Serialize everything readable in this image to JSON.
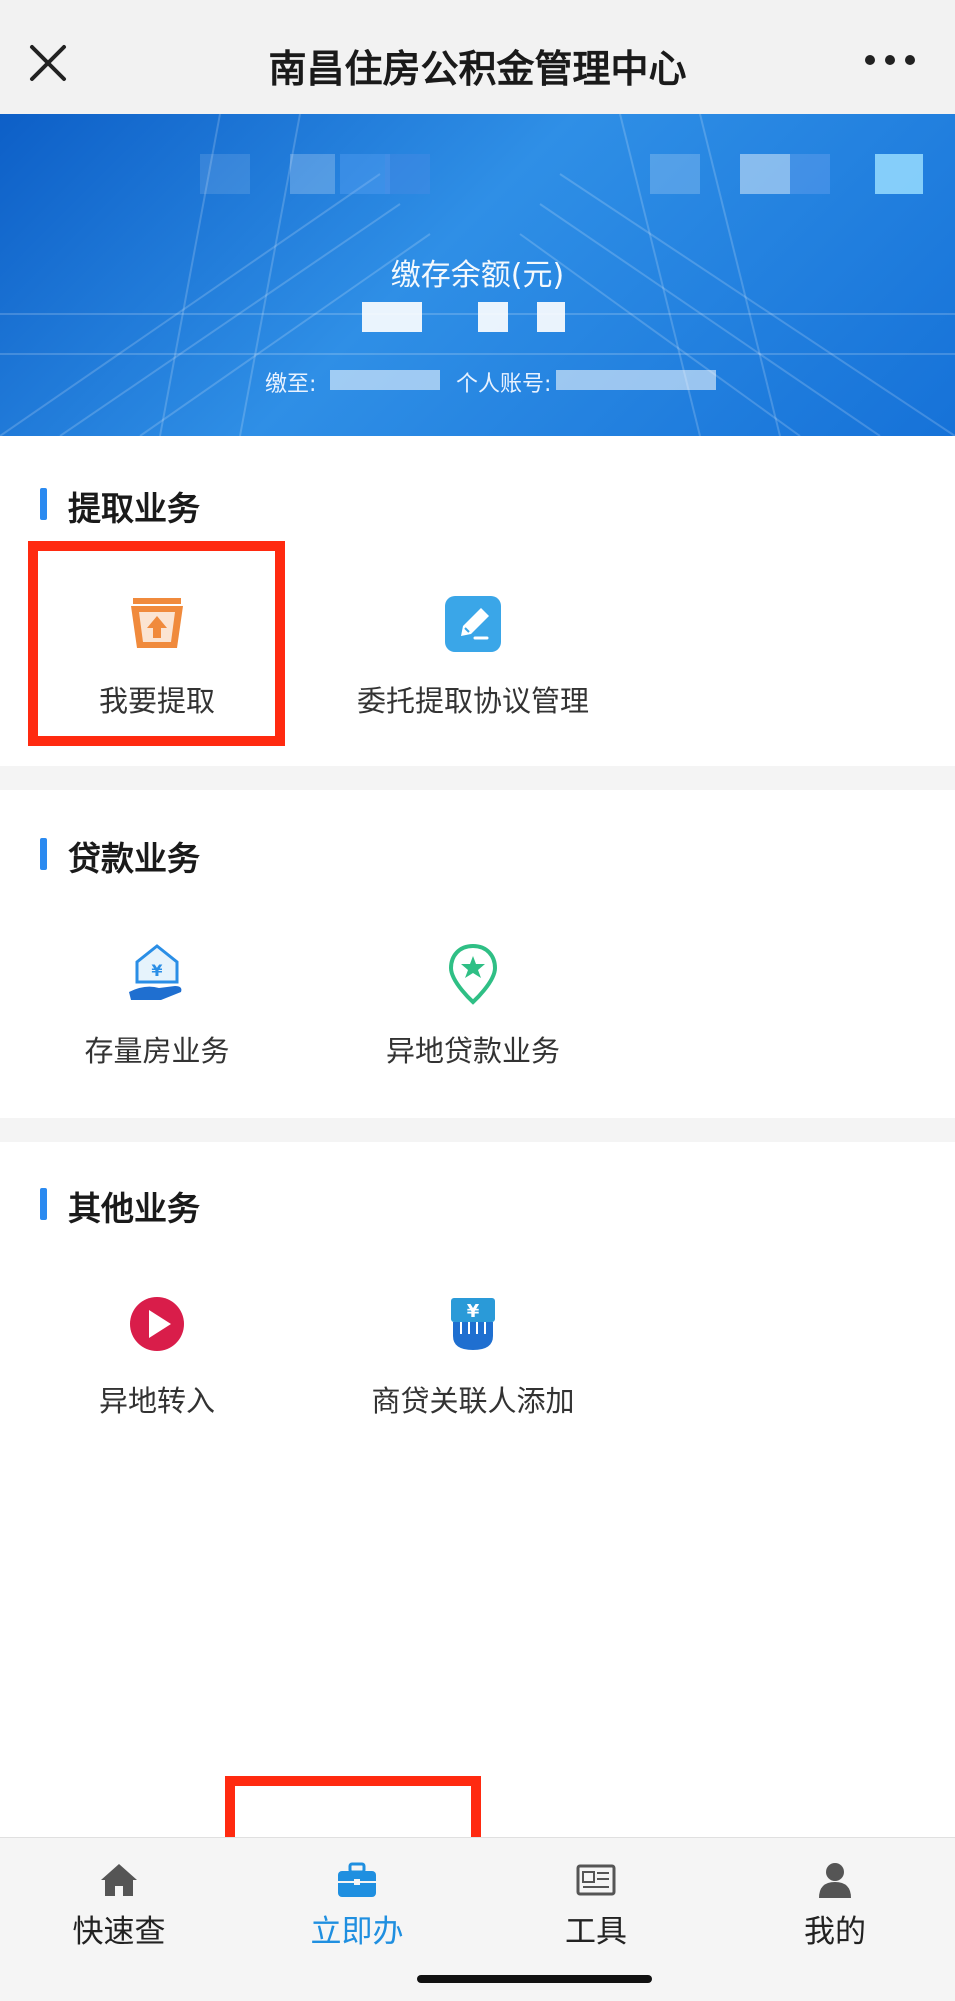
{
  "header": {
    "title": "南昌住房公积金管理中心",
    "close_icon": "close-icon",
    "more_icon": "more-icon"
  },
  "banner": {
    "balance_label": "缴存余额(元)",
    "paid_until_label": "缴至:",
    "account_label": "个人账号:"
  },
  "sections": [
    {
      "title": "提取业务",
      "items": [
        {
          "label": "我要提取",
          "icon": "withdraw-tray-icon"
        },
        {
          "label": "委托提取协议管理",
          "icon": "edit-pencil-icon"
        }
      ]
    },
    {
      "title": "贷款业务",
      "items": [
        {
          "label": "存量房业务",
          "icon": "house-in-hand-icon"
        },
        {
          "label": "异地贷款业务",
          "icon": "location-star-icon"
        }
      ]
    },
    {
      "title": "其他业务",
      "items": [
        {
          "label": "异地转入",
          "icon": "arrow-circle-icon"
        },
        {
          "label": "商贷关联人添加",
          "icon": "yen-hand-icon"
        }
      ]
    }
  ],
  "tabbar": {
    "tabs": [
      {
        "label": "快速查",
        "icon": "home-icon",
        "active": false
      },
      {
        "label": "立即办",
        "icon": "briefcase-icon",
        "active": true
      },
      {
        "label": "工具",
        "icon": "newspaper-icon",
        "active": false
      },
      {
        "label": "我的",
        "icon": "person-icon",
        "active": false
      }
    ]
  },
  "colors": {
    "accent": "#1f8fe0",
    "highlight": "#ff2a10",
    "section_bar": "#2b8af0",
    "banner": "#1672d8"
  }
}
